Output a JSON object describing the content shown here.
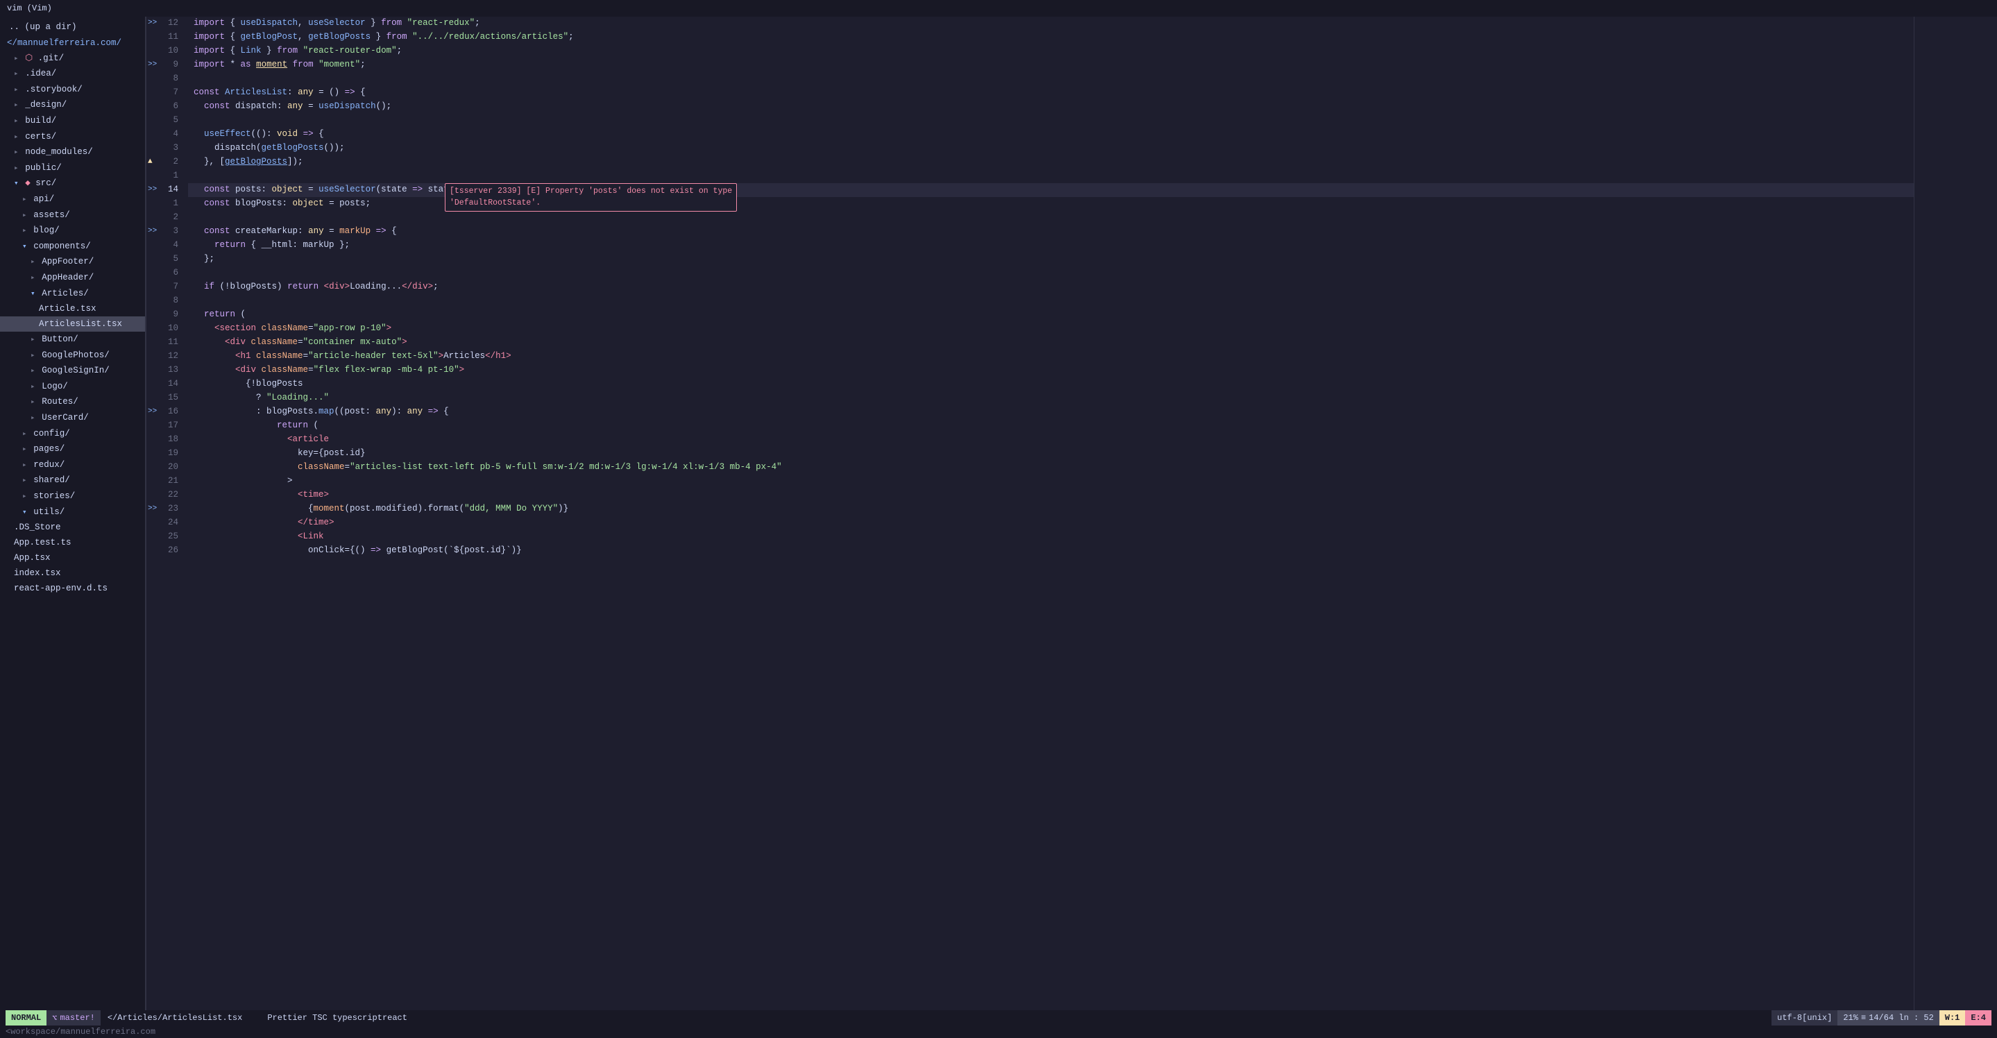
{
  "titleBar": {
    "label": "vim (Vim)"
  },
  "sidebar": {
    "items": [
      {
        "id": "up-dir",
        "indent": 0,
        "arrow": "",
        "icon": "",
        "label": ".. (up a dir)",
        "type": "dir",
        "active": false
      },
      {
        "id": "mannuelferreira",
        "indent": 0,
        "arrow": "",
        "icon": "",
        "label": "</mannuelferreira.com/",
        "type": "root",
        "active": false
      },
      {
        "id": "git",
        "indent": 1,
        "arrow": "▸",
        "icon": "",
        "label": ".git/",
        "type": "dir",
        "active": false
      },
      {
        "id": "idea",
        "indent": 1,
        "arrow": "▸",
        "icon": "",
        "label": ".idea/",
        "type": "dir",
        "active": false
      },
      {
        "id": "storybook",
        "indent": 1,
        "arrow": "▸",
        "icon": "",
        "label": ".storybook/",
        "type": "dir",
        "active": false
      },
      {
        "id": "design",
        "indent": 1,
        "arrow": "▸",
        "icon": "",
        "label": "_design/",
        "type": "dir",
        "active": false
      },
      {
        "id": "build",
        "indent": 1,
        "arrow": "▸",
        "icon": "",
        "label": "build/",
        "type": "dir",
        "active": false
      },
      {
        "id": "certs",
        "indent": 1,
        "arrow": "▸",
        "icon": "",
        "label": "certs/",
        "type": "dir",
        "active": false
      },
      {
        "id": "node_modules",
        "indent": 1,
        "arrow": "▸",
        "icon": "",
        "label": "node_modules/",
        "type": "dir",
        "active": false
      },
      {
        "id": "public",
        "indent": 1,
        "arrow": "▸",
        "icon": "",
        "label": "public/",
        "type": "dir",
        "active": false
      },
      {
        "id": "src",
        "indent": 1,
        "arrow": "▾",
        "icon": "",
        "label": "src/",
        "type": "dir-open",
        "active": false
      },
      {
        "id": "api",
        "indent": 2,
        "arrow": "▸",
        "icon": "",
        "label": "api/",
        "type": "dir",
        "active": false
      },
      {
        "id": "assets",
        "indent": 2,
        "arrow": "▸",
        "icon": "",
        "label": "assets/",
        "type": "dir",
        "active": false
      },
      {
        "id": "blog",
        "indent": 2,
        "arrow": "▸",
        "icon": "",
        "label": "blog/",
        "type": "dir",
        "active": false
      },
      {
        "id": "components",
        "indent": 2,
        "arrow": "▾",
        "icon": "",
        "label": "components/",
        "type": "dir-open",
        "active": false
      },
      {
        "id": "AppFooter",
        "indent": 3,
        "arrow": "▸",
        "icon": "",
        "label": "AppFooter/",
        "type": "dir",
        "active": false
      },
      {
        "id": "AppHeader",
        "indent": 3,
        "arrow": "▸",
        "icon": "",
        "label": "AppHeader/",
        "type": "dir",
        "active": false
      },
      {
        "id": "Articles",
        "indent": 3,
        "arrow": "▾",
        "icon": "",
        "label": "Articles/",
        "type": "dir-open",
        "active": false
      },
      {
        "id": "Article.tsx",
        "indent": 4,
        "arrow": "",
        "icon": "",
        "label": "Article.tsx",
        "type": "file",
        "active": false
      },
      {
        "id": "ArticlesList.tsx",
        "indent": 4,
        "arrow": "",
        "icon": "",
        "label": "ArticlesList.tsx",
        "type": "file",
        "active": true
      },
      {
        "id": "Button",
        "indent": 3,
        "arrow": "▸",
        "icon": "",
        "label": "Button/",
        "type": "dir",
        "active": false
      },
      {
        "id": "GooglePhotos",
        "indent": 3,
        "arrow": "▸",
        "icon": "",
        "label": "GooglePhotos/",
        "type": "dir",
        "active": false
      },
      {
        "id": "GoogleSignIn",
        "indent": 3,
        "arrow": "▸",
        "icon": "",
        "label": "GoogleSignIn/",
        "type": "dir",
        "active": false
      },
      {
        "id": "Logo",
        "indent": 3,
        "arrow": "▸",
        "icon": "",
        "label": "Logo/",
        "type": "dir",
        "active": false
      },
      {
        "id": "Routes",
        "indent": 3,
        "arrow": "▸",
        "icon": "",
        "label": "Routes/",
        "type": "dir",
        "active": false
      },
      {
        "id": "UserCard",
        "indent": 3,
        "arrow": "▸",
        "icon": "",
        "label": "UserCard/",
        "type": "dir",
        "active": false
      },
      {
        "id": "config",
        "indent": 2,
        "arrow": "▸",
        "icon": "",
        "label": "config/",
        "type": "dir",
        "active": false
      },
      {
        "id": "pages",
        "indent": 2,
        "arrow": "▸",
        "icon": "",
        "label": "pages/",
        "type": "dir",
        "active": false
      },
      {
        "id": "redux",
        "indent": 2,
        "arrow": "▸",
        "icon": "",
        "label": "redux/",
        "type": "dir",
        "active": false
      },
      {
        "id": "shared",
        "indent": 2,
        "arrow": "▸",
        "icon": "",
        "label": "shared/",
        "type": "dir",
        "active": false
      },
      {
        "id": "stories",
        "indent": 2,
        "arrow": "▸",
        "icon": "",
        "label": "stories/",
        "type": "dir",
        "active": false
      },
      {
        "id": "utils",
        "indent": 2,
        "arrow": "▾",
        "icon": "",
        "label": "utils/",
        "type": "dir",
        "active": false
      },
      {
        "id": "DS_Store",
        "indent": 1,
        "arrow": "",
        "icon": "",
        "label": ".DS_Store",
        "type": "file",
        "active": false
      },
      {
        "id": "App.test.ts",
        "indent": 1,
        "arrow": "",
        "icon": "",
        "label": "App.test.ts",
        "type": "file",
        "active": false
      },
      {
        "id": "App.tsx",
        "indent": 1,
        "arrow": "",
        "icon": "",
        "label": "App.tsx",
        "type": "file",
        "active": false
      },
      {
        "id": "index.tsx",
        "indent": 1,
        "arrow": "",
        "icon": "",
        "label": "index.tsx",
        "type": "file",
        "active": false
      },
      {
        "id": "react-app-env.d.ts",
        "indent": 1,
        "arrow": "",
        "icon": "",
        "label": "react-app-env.d.ts",
        "type": "file",
        "active": false
      }
    ]
  },
  "statusBar": {
    "mode": "NORMAL",
    "branch": "master!",
    "file": "</Articles/ArticlesList.tsx",
    "tools": "Prettier  TSC  typescriptreact",
    "encoding": "utf-8[unix]",
    "percent": "21%",
    "position": "14/64  ln : 52",
    "warnings": "W:1",
    "errors": "E:4"
  },
  "footer": {
    "path": "<workspace/mannuelferreira.com"
  }
}
